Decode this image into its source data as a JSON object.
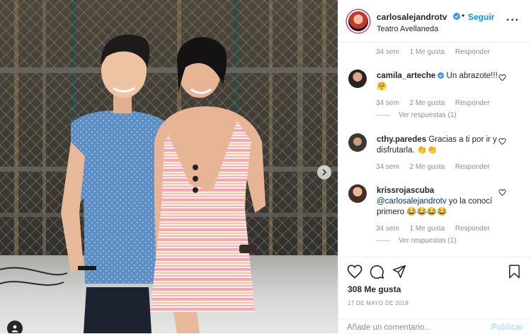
{
  "header": {
    "username": "carlosalejandrotv",
    "separator": "•",
    "follow_label": "Seguir",
    "location": "Teatro Avellaneda",
    "more_label": "···"
  },
  "comments": [
    {
      "meta": {
        "age": "34 sem",
        "likes": "1 Me gusta",
        "reply": "Responder"
      }
    },
    {
      "username": "camila_arteche",
      "verified": true,
      "text": "Un abrazote!!! 🤗",
      "meta": {
        "age": "34 sem",
        "likes": "2 Me gusta",
        "reply": "Responder"
      },
      "view_replies": "Ver respuestas (1)"
    },
    {
      "username": "cthy.paredes",
      "text": "Gracias a ti por ir y disfrutarla. 👏👏",
      "meta": {
        "age": "34 sem",
        "likes": "2 Me gusta",
        "reply": "Responder"
      }
    },
    {
      "username": "krissrojascuba",
      "mention": "@carlosalejandrotv",
      "text": "yo la conocí primero 😂😂😂😂",
      "meta": {
        "age": "34 sem",
        "likes": "1 Me gusta",
        "reply": "Responder"
      },
      "view_replies": "Ver respuestas (1)"
    }
  ],
  "actions": {
    "like_icon": "heart-icon",
    "comment_icon": "comment-icon",
    "share_icon": "share-icon",
    "save_icon": "bookmark-icon"
  },
  "likes": "308 Me gusta",
  "date": "17 DE MAYO DE 2019",
  "add_comment": {
    "placeholder": "Añade un comentario...",
    "publish_label": "Publicar"
  },
  "colors": {
    "link": "#0095f6",
    "publish_disabled": "#b2dffc",
    "secondary_text": "#8e8e8e"
  }
}
